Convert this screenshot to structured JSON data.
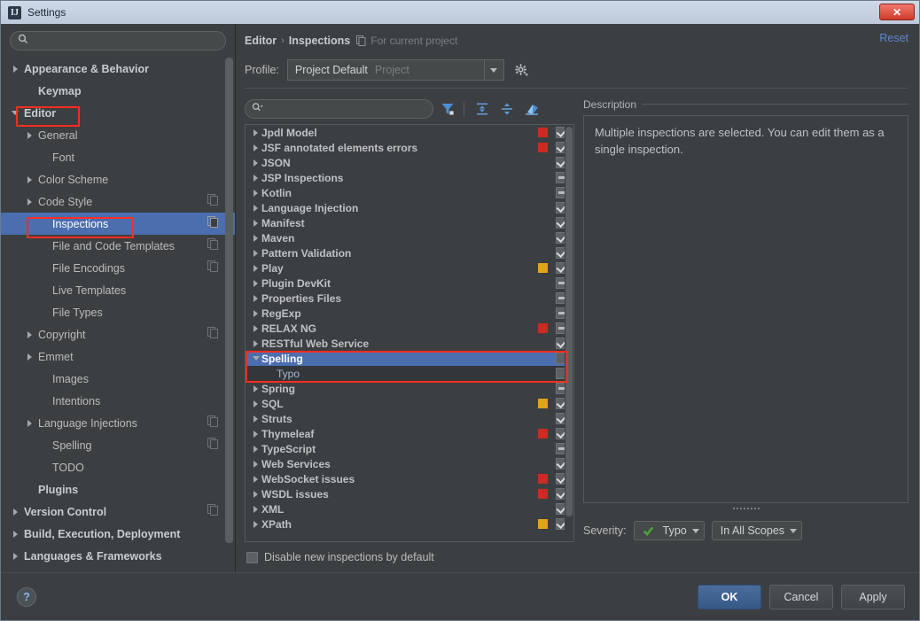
{
  "window": {
    "title": "Settings",
    "app_icon": "IJ",
    "close_label": "✕"
  },
  "sidebar": {
    "search_placeholder": "",
    "search_value": "",
    "search_icon": "search-icon",
    "items": [
      {
        "label": "Appearance & Behavior",
        "indent": 0,
        "twisty": "right",
        "bold": true,
        "selected": false,
        "cfg": false
      },
      {
        "label": "Keymap",
        "indent": 1,
        "twisty": "none",
        "bold": true,
        "selected": false,
        "cfg": false
      },
      {
        "label": "Editor",
        "indent": 0,
        "twisty": "down",
        "bold": true,
        "selected": false,
        "cfg": false
      },
      {
        "label": "General",
        "indent": 1,
        "twisty": "right",
        "bold": false,
        "selected": false,
        "cfg": false
      },
      {
        "label": "Font",
        "indent": 2,
        "twisty": "none",
        "bold": false,
        "selected": false,
        "cfg": false
      },
      {
        "label": "Color Scheme",
        "indent": 1,
        "twisty": "right",
        "bold": false,
        "selected": false,
        "cfg": false
      },
      {
        "label": "Code Style",
        "indent": 1,
        "twisty": "right",
        "bold": false,
        "selected": false,
        "cfg": true
      },
      {
        "label": "Inspections",
        "indent": 2,
        "twisty": "none",
        "bold": false,
        "selected": true,
        "cfg": true
      },
      {
        "label": "File and Code Templates",
        "indent": 2,
        "twisty": "none",
        "bold": false,
        "selected": false,
        "cfg": true
      },
      {
        "label": "File Encodings",
        "indent": 2,
        "twisty": "none",
        "bold": false,
        "selected": false,
        "cfg": true
      },
      {
        "label": "Live Templates",
        "indent": 2,
        "twisty": "none",
        "bold": false,
        "selected": false,
        "cfg": false
      },
      {
        "label": "File Types",
        "indent": 2,
        "twisty": "none",
        "bold": false,
        "selected": false,
        "cfg": false
      },
      {
        "label": "Copyright",
        "indent": 1,
        "twisty": "right",
        "bold": false,
        "selected": false,
        "cfg": true
      },
      {
        "label": "Emmet",
        "indent": 1,
        "twisty": "right",
        "bold": false,
        "selected": false,
        "cfg": false
      },
      {
        "label": "Images",
        "indent": 2,
        "twisty": "none",
        "bold": false,
        "selected": false,
        "cfg": false
      },
      {
        "label": "Intentions",
        "indent": 2,
        "twisty": "none",
        "bold": false,
        "selected": false,
        "cfg": false
      },
      {
        "label": "Language Injections",
        "indent": 1,
        "twisty": "right",
        "bold": false,
        "selected": false,
        "cfg": true
      },
      {
        "label": "Spelling",
        "indent": 2,
        "twisty": "none",
        "bold": false,
        "selected": false,
        "cfg": true
      },
      {
        "label": "TODO",
        "indent": 2,
        "twisty": "none",
        "bold": false,
        "selected": false,
        "cfg": false
      },
      {
        "label": "Plugins",
        "indent": 1,
        "twisty": "none",
        "bold": true,
        "selected": false,
        "cfg": false
      },
      {
        "label": "Version Control",
        "indent": 0,
        "twisty": "right",
        "bold": true,
        "selected": false,
        "cfg": true
      },
      {
        "label": "Build, Execution, Deployment",
        "indent": 0,
        "twisty": "right",
        "bold": true,
        "selected": false,
        "cfg": false
      },
      {
        "label": "Languages & Frameworks",
        "indent": 0,
        "twisty": "right",
        "bold": true,
        "selected": false,
        "cfg": false
      }
    ]
  },
  "header": {
    "breadcrumb_parent": "Editor",
    "breadcrumb_sep": "›",
    "breadcrumb_current": "Inspections",
    "scope_note": "For current project",
    "scope_icon": "project-scope-icon",
    "reset_label": "Reset"
  },
  "profile": {
    "label": "Profile:",
    "value": "Project Default",
    "sub_value": "Project",
    "dropdown_icon": "chevron-down-icon",
    "gear_icon": "gear-icon"
  },
  "toolbar": {
    "search_placeholder": "",
    "search_value": "",
    "search_icon": "search-icon",
    "filter_icon": "filter-funnel-icon",
    "expand_icon": "expand-all-icon",
    "collapse_icon": "collapse-all-icon",
    "reset_icon": "reset-to-defaults-icon"
  },
  "inspections": {
    "rows": [
      {
        "label": "Jpdl Model",
        "child": false,
        "twisty": "right",
        "severity": "#cc2a22",
        "check": "checked",
        "selected": false
      },
      {
        "label": "JSF annotated elements errors",
        "child": false,
        "twisty": "right",
        "severity": "#cc2a22",
        "check": "checked",
        "selected": false
      },
      {
        "label": "JSON",
        "child": false,
        "twisty": "right",
        "severity": "",
        "check": "checked",
        "selected": false
      },
      {
        "label": "JSP Inspections",
        "child": false,
        "twisty": "right",
        "severity": "",
        "check": "mixed",
        "selected": false
      },
      {
        "label": "Kotlin",
        "child": false,
        "twisty": "right",
        "severity": "",
        "check": "mixed",
        "selected": false
      },
      {
        "label": "Language Injection",
        "child": false,
        "twisty": "right",
        "severity": "",
        "check": "checked",
        "selected": false
      },
      {
        "label": "Manifest",
        "child": false,
        "twisty": "right",
        "severity": "",
        "check": "checked",
        "selected": false
      },
      {
        "label": "Maven",
        "child": false,
        "twisty": "right",
        "severity": "",
        "check": "checked",
        "selected": false
      },
      {
        "label": "Pattern Validation",
        "child": false,
        "twisty": "right",
        "severity": "",
        "check": "checked",
        "selected": false
      },
      {
        "label": "Play",
        "child": false,
        "twisty": "right",
        "severity": "#e0a31a",
        "check": "checked",
        "selected": false
      },
      {
        "label": "Plugin DevKit",
        "child": false,
        "twisty": "right",
        "severity": "",
        "check": "mixed",
        "selected": false
      },
      {
        "label": "Properties Files",
        "child": false,
        "twisty": "right",
        "severity": "",
        "check": "mixed",
        "selected": false
      },
      {
        "label": "RegExp",
        "child": false,
        "twisty": "right",
        "severity": "",
        "check": "mixed",
        "selected": false
      },
      {
        "label": "RELAX NG",
        "child": false,
        "twisty": "right",
        "severity": "#cc2a22",
        "check": "mixed",
        "selected": false
      },
      {
        "label": "RESTful Web Service",
        "child": false,
        "twisty": "right",
        "severity": "",
        "check": "checked",
        "selected": false
      },
      {
        "label": "Spelling",
        "child": false,
        "twisty": "down",
        "severity": "",
        "check": "empty",
        "selected": true
      },
      {
        "label": "Typo",
        "child": true,
        "twisty": "none",
        "severity": "",
        "check": "empty",
        "selected": false,
        "highlight": true
      },
      {
        "label": "Spring",
        "child": false,
        "twisty": "right",
        "severity": "",
        "check": "mixed",
        "selected": false
      },
      {
        "label": "SQL",
        "child": false,
        "twisty": "right",
        "severity": "#e0a31a",
        "check": "checked",
        "selected": false
      },
      {
        "label": "Struts",
        "child": false,
        "twisty": "right",
        "severity": "",
        "check": "checked",
        "selected": false
      },
      {
        "label": "Thymeleaf",
        "child": false,
        "twisty": "right",
        "severity": "#cc2a22",
        "check": "checked",
        "selected": false
      },
      {
        "label": "TypeScript",
        "child": false,
        "twisty": "right",
        "severity": "",
        "check": "mixed",
        "selected": false
      },
      {
        "label": "Web Services",
        "child": false,
        "twisty": "right",
        "severity": "",
        "check": "checked",
        "selected": false
      },
      {
        "label": "WebSocket issues",
        "child": false,
        "twisty": "right",
        "severity": "#cc2a22",
        "check": "checked",
        "selected": false
      },
      {
        "label": "WSDL issues",
        "child": false,
        "twisty": "right",
        "severity": "#cc2a22",
        "check": "checked",
        "selected": false
      },
      {
        "label": "XML",
        "child": false,
        "twisty": "right",
        "severity": "",
        "check": "checked",
        "selected": false
      },
      {
        "label": "XPath",
        "child": false,
        "twisty": "right",
        "severity": "#e0a31a",
        "check": "checked",
        "selected": false
      }
    ]
  },
  "description": {
    "legend": "Description",
    "text": "Multiple inspections are selected. You can edit them as a single inspection."
  },
  "severity": {
    "label": "Severity:",
    "value": "Typo",
    "value_icon": "green-check-icon",
    "scope_value": "In All Scopes",
    "dropdown_icon": "chevron-down-icon"
  },
  "options": {
    "disable_new_label": "Disable new inspections by default",
    "disable_new_checked": false
  },
  "footer": {
    "help_label": "?",
    "ok_label": "OK",
    "cancel_label": "Cancel",
    "apply_label": "Apply"
  },
  "colors": {
    "selection_blue": "#4b6eaf",
    "annotation_red": "#ff2d20",
    "error_red": "#cc2a22",
    "warning_yellow": "#e0a31a",
    "link_blue": "#5a87d1"
  }
}
